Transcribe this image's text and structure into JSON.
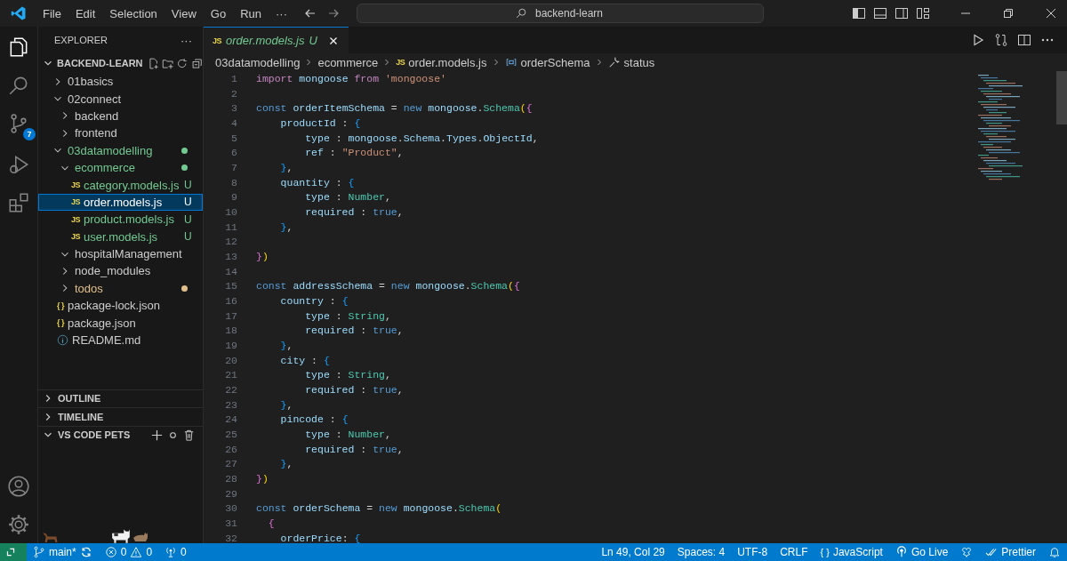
{
  "menu": [
    "File",
    "Edit",
    "Selection",
    "View",
    "Go",
    "Run",
    "···"
  ],
  "command_center": {
    "placeholder": "backend-learn"
  },
  "activity_bar": {
    "source_control_badge": "7"
  },
  "explorer": {
    "title": "EXPLORER",
    "more": "···",
    "root": "BACKEND-LEARN",
    "root_expanded": true,
    "tree": [
      {
        "name": "01basics",
        "kind": "folder",
        "expanded": false,
        "selected": false
      },
      {
        "name": "02connect",
        "kind": "folder",
        "expanded": true,
        "selected": false,
        "children": [
          {
            "name": "backend",
            "kind": "folder",
            "expanded": false,
            "selected": false
          },
          {
            "name": "frontend",
            "kind": "folder",
            "expanded": false,
            "selected": false
          }
        ]
      },
      {
        "name": "03datamodelling",
        "kind": "folder",
        "expanded": true,
        "selected": false,
        "color": "#73c991",
        "dot": true,
        "children": [
          {
            "name": "ecommerce",
            "kind": "folder",
            "expanded": true,
            "selected": false,
            "color": "#73c991",
            "dot": true,
            "children": [
              {
                "name": "category.models.js",
                "kind": "file",
                "badge": "JS",
                "selected": false,
                "color": "#73c991",
                "status": "U"
              },
              {
                "name": "order.models.js",
                "kind": "file",
                "badge": "JS",
                "selected": true,
                "status": "U"
              },
              {
                "name": "product.models.js",
                "kind": "file",
                "badge": "JS",
                "selected": false,
                "color": "#73c991",
                "status": "U"
              },
              {
                "name": "user.models.js",
                "kind": "file",
                "badge": "JS",
                "selected": false,
                "color": "#73c991",
                "status": "U"
              }
            ]
          },
          {
            "name": "hospitalManagement",
            "kind": "folder",
            "expanded": true,
            "selected": false
          },
          {
            "name": "node_modules",
            "kind": "folder",
            "expanded": false,
            "selected": false
          },
          {
            "name": "todos",
            "kind": "folder",
            "expanded": false,
            "selected": false,
            "color": "#e2c08d",
            "dot": true
          }
        ]
      },
      {
        "name": "package-lock.json",
        "kind": "file",
        "badge": "{ }",
        "selected": false
      },
      {
        "name": "package.json",
        "kind": "file",
        "badge": "{ }",
        "selected": false
      },
      {
        "name": "README.md",
        "kind": "info",
        "selected": false
      }
    ]
  },
  "panels": [
    {
      "title": "OUTLINE",
      "expanded": false
    },
    {
      "title": "TIMELINE",
      "expanded": false
    },
    {
      "title": "VS CODE PETS",
      "expanded": true
    }
  ],
  "tab": {
    "badge": "JS",
    "name": "order.models.js",
    "status": "U",
    "selected": true
  },
  "breadcrumbs": [
    {
      "text": "03datamodelling",
      "kind": "folder"
    },
    {
      "text": "ecommerce",
      "kind": "folder"
    },
    {
      "text": "order.models.js",
      "kind": "js",
      "badge": "JS"
    },
    {
      "text": "orderSchema",
      "kind": "variable"
    },
    {
      "text": "status",
      "kind": "property"
    }
  ],
  "code": [
    {
      "number": "1",
      "tokens": [
        {
          "kind": "control",
          "text": "import"
        },
        {
          "kind": "variable",
          "text": " mongoose"
        },
        {
          "kind": "control",
          "text": " from"
        },
        {
          "kind": "string",
          "text": " 'mongoose'"
        }
      ]
    },
    {
      "number": "2"
    },
    {
      "number": "3",
      "tokens": [
        {
          "kind": "keyword",
          "text": "const"
        },
        {
          "kind": "variable",
          "text": " orderItemSchema"
        },
        {
          "kind": "plain",
          "text": " = "
        },
        {
          "kind": "keyword",
          "text": "new"
        },
        {
          "kind": "variable",
          "text": " mongoose"
        },
        {
          "kind": "plain",
          "text": "."
        },
        {
          "kind": "class",
          "text": "Schema"
        },
        {
          "kind": "bracket1",
          "text": "("
        },
        {
          "kind": "bracket2",
          "text": "{"
        }
      ]
    },
    {
      "number": "4",
      "tokens": [
        {
          "kind": "variable",
          "text": "    productId"
        },
        {
          "kind": "plain",
          "text": " : "
        },
        {
          "kind": "bracket3",
          "text": "{"
        }
      ]
    },
    {
      "number": "5",
      "tokens": [
        {
          "kind": "variable",
          "text": "        type"
        },
        {
          "kind": "plain",
          "text": " : "
        },
        {
          "kind": "variable",
          "text": "mongoose"
        },
        {
          "kind": "plain",
          "text": "."
        },
        {
          "kind": "variable",
          "text": "Schema"
        },
        {
          "kind": "plain",
          "text": "."
        },
        {
          "kind": "variable",
          "text": "Types"
        },
        {
          "kind": "plain",
          "text": "."
        },
        {
          "kind": "variable",
          "text": "ObjectId"
        },
        {
          "kind": "plain",
          "text": ","
        }
      ]
    },
    {
      "number": "6",
      "tokens": [
        {
          "kind": "variable",
          "text": "        ref"
        },
        {
          "kind": "plain",
          "text": " : "
        },
        {
          "kind": "string",
          "text": "\"Product\""
        },
        {
          "kind": "plain",
          "text": ","
        }
      ]
    },
    {
      "number": "7",
      "tokens": [
        {
          "kind": "bracket3",
          "text": "    }"
        },
        {
          "kind": "plain",
          "text": ","
        }
      ]
    },
    {
      "number": "8",
      "tokens": [
        {
          "kind": "variable",
          "text": "    quantity"
        },
        {
          "kind": "plain",
          "text": " : "
        },
        {
          "kind": "bracket3",
          "text": "{"
        }
      ]
    },
    {
      "number": "9",
      "tokens": [
        {
          "kind": "variable",
          "text": "        type"
        },
        {
          "kind": "plain",
          "text": " : "
        },
        {
          "kind": "class",
          "text": "Number"
        },
        {
          "kind": "plain",
          "text": ","
        }
      ]
    },
    {
      "number": "10",
      "tokens": [
        {
          "kind": "variable",
          "text": "        required"
        },
        {
          "kind": "plain",
          "text": " : "
        },
        {
          "kind": "keyword",
          "text": "true"
        },
        {
          "kind": "plain",
          "text": ","
        }
      ]
    },
    {
      "number": "11",
      "tokens": [
        {
          "kind": "bracket3",
          "text": "    }"
        },
        {
          "kind": "plain",
          "text": ","
        }
      ]
    },
    {
      "number": "12"
    },
    {
      "number": "13",
      "tokens": [
        {
          "kind": "bracket2",
          "text": "}"
        },
        {
          "kind": "bracket1",
          "text": ")"
        }
      ]
    },
    {
      "number": "14"
    },
    {
      "number": "15",
      "tokens": [
        {
          "kind": "keyword",
          "text": "const"
        },
        {
          "kind": "variable",
          "text": " addressSchema"
        },
        {
          "kind": "plain",
          "text": " = "
        },
        {
          "kind": "keyword",
          "text": "new"
        },
        {
          "kind": "variable",
          "text": " mongoose"
        },
        {
          "kind": "plain",
          "text": "."
        },
        {
          "kind": "class",
          "text": "Schema"
        },
        {
          "kind": "bracket1",
          "text": "("
        },
        {
          "kind": "bracket2",
          "text": "{"
        }
      ]
    },
    {
      "number": "16",
      "tokens": [
        {
          "kind": "variable",
          "text": "    country"
        },
        {
          "kind": "plain",
          "text": " : "
        },
        {
          "kind": "bracket3",
          "text": "{"
        }
      ]
    },
    {
      "number": "17",
      "tokens": [
        {
          "kind": "variable",
          "text": "        type"
        },
        {
          "kind": "plain",
          "text": " : "
        },
        {
          "kind": "class",
          "text": "String"
        },
        {
          "kind": "plain",
          "text": ","
        }
      ]
    },
    {
      "number": "18",
      "tokens": [
        {
          "kind": "variable",
          "text": "        required"
        },
        {
          "kind": "plain",
          "text": " : "
        },
        {
          "kind": "keyword",
          "text": "true"
        },
        {
          "kind": "plain",
          "text": ","
        }
      ]
    },
    {
      "number": "19",
      "tokens": [
        {
          "kind": "bracket3",
          "text": "    }"
        },
        {
          "kind": "plain",
          "text": ","
        }
      ]
    },
    {
      "number": "20",
      "tokens": [
        {
          "kind": "variable",
          "text": "    city"
        },
        {
          "kind": "plain",
          "text": " : "
        },
        {
          "kind": "bracket3",
          "text": "{"
        }
      ]
    },
    {
      "number": "21",
      "tokens": [
        {
          "kind": "variable",
          "text": "        type"
        },
        {
          "kind": "plain",
          "text": " : "
        },
        {
          "kind": "class",
          "text": "String"
        },
        {
          "kind": "plain",
          "text": ","
        }
      ]
    },
    {
      "number": "22",
      "tokens": [
        {
          "kind": "variable",
          "text": "        required"
        },
        {
          "kind": "plain",
          "text": " : "
        },
        {
          "kind": "keyword",
          "text": "true"
        },
        {
          "kind": "plain",
          "text": ","
        }
      ]
    },
    {
      "number": "23",
      "tokens": [
        {
          "kind": "bracket3",
          "text": "    }"
        },
        {
          "kind": "plain",
          "text": ","
        }
      ]
    },
    {
      "number": "24",
      "tokens": [
        {
          "kind": "variable",
          "text": "    pincode"
        },
        {
          "kind": "plain",
          "text": " : "
        },
        {
          "kind": "bracket3",
          "text": "{"
        }
      ]
    },
    {
      "number": "25",
      "tokens": [
        {
          "kind": "variable",
          "text": "        type"
        },
        {
          "kind": "plain",
          "text": " : "
        },
        {
          "kind": "class",
          "text": "Number"
        },
        {
          "kind": "plain",
          "text": ","
        }
      ]
    },
    {
      "number": "26",
      "tokens": [
        {
          "kind": "variable",
          "text": "        required"
        },
        {
          "kind": "plain",
          "text": " : "
        },
        {
          "kind": "keyword",
          "text": "true"
        },
        {
          "kind": "plain",
          "text": ","
        }
      ]
    },
    {
      "number": "27",
      "tokens": [
        {
          "kind": "bracket3",
          "text": "    }"
        },
        {
          "kind": "plain",
          "text": ","
        }
      ]
    },
    {
      "number": "28",
      "tokens": [
        {
          "kind": "bracket2",
          "text": "}"
        },
        {
          "kind": "bracket1",
          "text": ")"
        }
      ]
    },
    {
      "number": "29"
    },
    {
      "number": "30",
      "tokens": [
        {
          "kind": "keyword",
          "text": "const"
        },
        {
          "kind": "variable",
          "text": " orderSchema"
        },
        {
          "kind": "plain",
          "text": " = "
        },
        {
          "kind": "keyword",
          "text": "new"
        },
        {
          "kind": "variable",
          "text": " mongoose"
        },
        {
          "kind": "plain",
          "text": "."
        },
        {
          "kind": "class",
          "text": "Schema"
        },
        {
          "kind": "bracket1",
          "text": "("
        }
      ]
    },
    {
      "number": "31",
      "tokens": [
        {
          "kind": "bracket2",
          "text": "  {"
        }
      ]
    },
    {
      "number": "32",
      "tokens": [
        {
          "kind": "variable",
          "text": "    orderPrice"
        },
        {
          "kind": "plain",
          "text": ": "
        },
        {
          "kind": "bracket3",
          "text": "{"
        }
      ]
    }
  ],
  "status_bar": {
    "branch": "main*",
    "errors": "0",
    "warnings": "0",
    "ports": "0",
    "right": [
      {
        "kind": "text",
        "text": "Ln 49, Col 29"
      },
      {
        "kind": "text",
        "text": "Spaces: 4"
      },
      {
        "kind": "text",
        "text": "UTF-8"
      },
      {
        "kind": "text",
        "text": "CRLF"
      },
      {
        "kind": "language",
        "icon_text": "{ }",
        "text": "JavaScript"
      },
      {
        "kind": "live",
        "text": "Go Live"
      },
      {
        "kind": "feedback"
      },
      {
        "kind": "formatter",
        "text": "Prettier"
      },
      {
        "kind": "bell"
      }
    ]
  }
}
